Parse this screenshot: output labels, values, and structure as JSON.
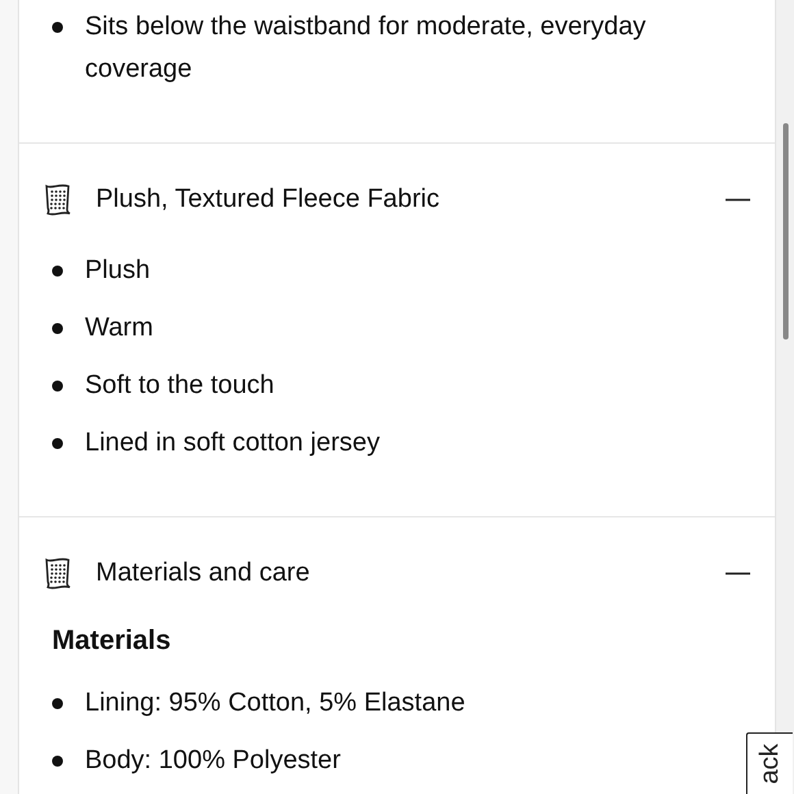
{
  "top_section": {
    "bullets": [
      "Sits below the waistband for moderate, everyday coverage"
    ]
  },
  "accordions": [
    {
      "title": "Plush, Textured Fleece Fabric",
      "expanded": true,
      "bullets": [
        "Plush",
        "Warm",
        "Soft to the touch",
        "Lined in soft cotton jersey"
      ]
    },
    {
      "title": "Materials and care",
      "expanded": true,
      "subheading": "Materials",
      "bullets": [
        "Lining: 95% Cotton, 5% Elastane",
        "Body: 100% Polyester"
      ]
    }
  ],
  "feedback_tab": {
    "label": "ack"
  }
}
